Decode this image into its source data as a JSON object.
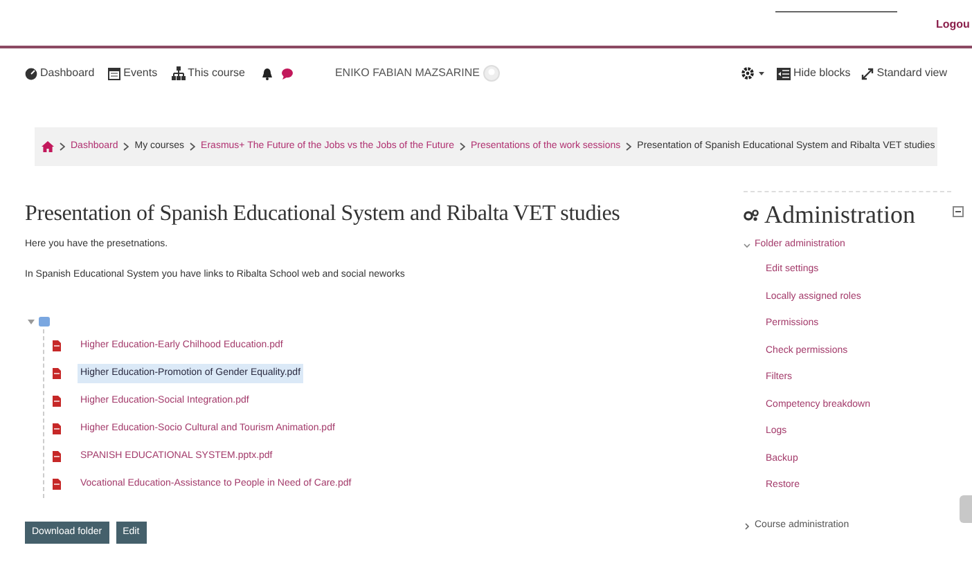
{
  "header": {
    "logout": "Logou"
  },
  "navbar": {
    "items": [
      {
        "kind": "dashboard",
        "label": "Dashboard"
      },
      {
        "kind": "calendar",
        "label": "Events"
      },
      {
        "kind": "sitemap",
        "label": "This course"
      }
    ],
    "user": "ENIKO FABIAN MAZSARINE",
    "right": [
      {
        "kind": "gear"
      },
      {
        "kind": "hide",
        "label": "Hide blocks"
      },
      {
        "kind": "expand",
        "label": "Standard view"
      }
    ]
  },
  "breadcrumb": [
    {
      "label": "Dashboard",
      "link": true
    },
    {
      "label": "My courses",
      "link": false
    },
    {
      "label": "Erasmus+ The Future of the Jobs vs the Jobs of the Future",
      "link": true
    },
    {
      "label": "Presentations of the work sessions",
      "link": true
    },
    {
      "label": "Presentation of Spanish Educational System and Ribalta VET studies",
      "link": false
    }
  ],
  "main": {
    "title": "Presentation of Spanish Educational System and Ribalta VET studies",
    "paragraphs": [
      "Here you have the presetnations.",
      "In Spanish Educational System you have links to Ribalta School web and social neworks"
    ],
    "tree": {
      "expanded": true,
      "files": [
        {
          "name": "Higher Education-Early Chilhood Education.pdf",
          "selected": false
        },
        {
          "name": "Higher Education-Promotion of Gender Equality.pdf",
          "selected": true
        },
        {
          "name": "Higher Education-Social Integration.pdf",
          "selected": false
        },
        {
          "name": "Higher Education-Socio Cultural and Tourism Animation.pdf",
          "selected": false
        },
        {
          "name": "SPANISH EDUCATIONAL SYSTEM.pptx.pdf",
          "selected": false
        },
        {
          "name": "Vocational Education-Assistance to People in Need of Care.pdf",
          "selected": false
        }
      ]
    },
    "buttons": [
      "Download folder",
      "Edit"
    ]
  },
  "sidebar": {
    "title": "Administration",
    "sections": [
      {
        "label": "Folder administration",
        "expanded": true,
        "children": [
          "Edit settings",
          "Locally assigned roles",
          "Permissions",
          "Check permissions",
          "Filters",
          "Competency breakdown",
          "Logs",
          "Backup",
          "Restore"
        ]
      },
      {
        "label": "Course administration",
        "expanded": false
      }
    ]
  }
}
